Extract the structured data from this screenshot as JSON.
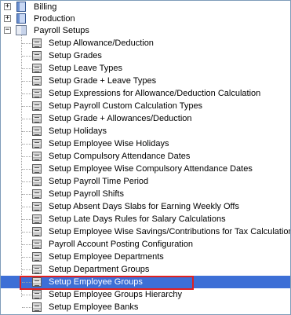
{
  "tree": {
    "top_nodes": [
      {
        "label": "Billing",
        "expander": "+"
      },
      {
        "label": "Production",
        "expander": "+"
      },
      {
        "label": "Payroll Setups",
        "expander": "−"
      }
    ],
    "payroll_items": [
      "Setup Allowance/Deduction",
      "Setup Grades",
      "Setup Leave Types",
      "Setup Grade + Leave Types",
      "Setup Expressions for Allowance/Deduction Calculation",
      "Setup Payroll Custom Calculation Types",
      "Setup Grade + Allowances/Deduction",
      "Setup Holidays",
      "Setup Employee Wise Holidays",
      "Setup Compulsory Attendance Dates",
      "Setup Employee Wise Compulsory Attendance Dates",
      "Setup Payroll Time Period",
      "Setup Payroll Shifts",
      "Setup Absent Days Slabs for Earning Weekly Offs",
      "Setup Late Days Rules for Salary Calculations",
      "Setup Employee Wise Savings/Contributions for Tax Calculation",
      "Payroll Account Posting Configuration",
      "Setup Employee Departments",
      "Setup Department Groups",
      "Setup Employee Groups",
      "Setup Employee Groups Hierarchy",
      "Setup Employee Banks"
    ],
    "selected_item": "Setup Employee Groups"
  },
  "colors": {
    "selection": "#3d6fd6",
    "highlight_border": "#e02020"
  },
  "icons": {
    "folder": "folder-icon",
    "open_book": "open-book-icon",
    "ledger": "ledger-icon"
  }
}
